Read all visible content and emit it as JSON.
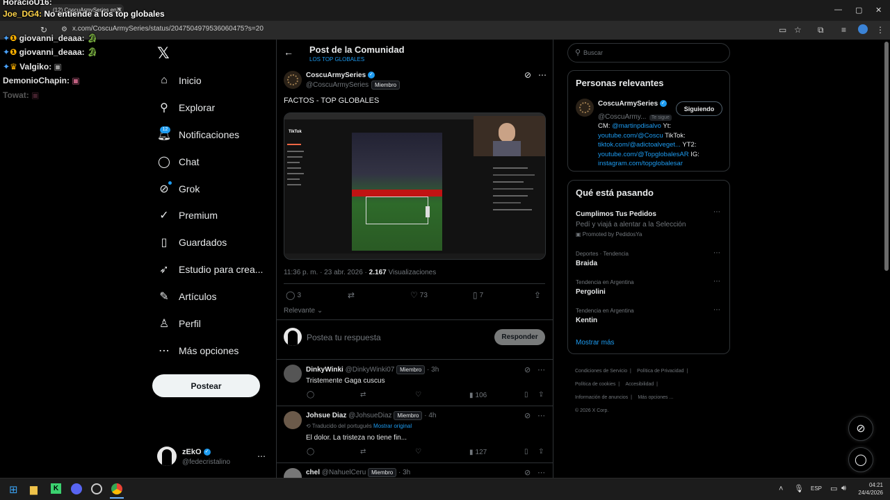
{
  "browser": {
    "tab_title": "(12) CoscuArmySeries en X",
    "url": "x.com/CoscuArmySeries/status/2047504979536060475?s=20"
  },
  "chat_overlay": {
    "top_user": "HoracioU16:",
    "lines": [
      {
        "user": "Joe_DG4:",
        "message": "No entiende a los top globales"
      },
      {
        "user": "giovanni_deaaa:",
        "message": ""
      },
      {
        "user": "giovanni_deaaa:",
        "message": ""
      },
      {
        "user": "Valgiko:",
        "message": ""
      },
      {
        "user": "DemonioChapin:",
        "message": ""
      },
      {
        "user": "Towat:",
        "message": ""
      }
    ]
  },
  "nav": {
    "items": [
      {
        "label": "Inicio",
        "icon": "home-icon",
        "glyph": "⌂"
      },
      {
        "label": "Explorar",
        "icon": "search-icon",
        "glyph": "⚲"
      },
      {
        "label": "Notificaciones",
        "icon": "bell-icon",
        "glyph": "🔔︎"
      },
      {
        "label": "Chat",
        "icon": "chat-icon",
        "glyph": "◯"
      },
      {
        "label": "Grok",
        "icon": "grok-icon",
        "glyph": "⊘"
      },
      {
        "label": "Premium",
        "icon": "premium-icon",
        "glyph": "✓"
      },
      {
        "label": "Guardados",
        "icon": "bookmark-icon",
        "glyph": "▯"
      },
      {
        "label": "Estudio para crea...",
        "icon": "rocket-icon",
        "glyph": "➶"
      },
      {
        "label": "Artículos",
        "icon": "article-icon",
        "glyph": "✎"
      },
      {
        "label": "Perfil",
        "icon": "person-icon",
        "glyph": "♙"
      },
      {
        "label": "Más opciones",
        "icon": "more-circle-icon",
        "glyph": "⋯"
      }
    ],
    "notif_badge": "12",
    "post_label": "Postear",
    "account_name": "zEkO",
    "account_handle": "@fedecristalino"
  },
  "post": {
    "header_title": "Post de la Comunidad",
    "header_sub": "LOS TOP GLOBALES",
    "author_name": "CoscuArmySeries",
    "author_handle": "@CoscuArmySeries",
    "member_tag": "Miembro",
    "text": "FACTOS - TOP GLOBALES",
    "timestamp": "11:36 p. m. · 23 abr. 2026 ·",
    "views": "2.167",
    "views_label": "Visualizaciones",
    "replies": "3",
    "likes": "73",
    "bookmarks": "7",
    "sort_label": "Relevante",
    "reply_placeholder": "Postea tu respuesta",
    "reply_button": "Responder",
    "video_logo": "TikTok"
  },
  "replies": [
    {
      "name": "DinkyWinki",
      "handle": "@DinkyWinki07",
      "tag": "Miembro",
      "time": "3h",
      "translated": "",
      "show_original": "",
      "text": "Tristemente Gaga cuscus",
      "views": "106"
    },
    {
      "name": "Johsue Diaz",
      "handle": "@JohsueDiaz",
      "tag": "Miembro",
      "time": "4h",
      "translated": "Traducido del portugués",
      "show_original": "Mostrar original",
      "text": "El dolor. La tristeza no tiene fin...",
      "views": "127"
    },
    {
      "name": "chel",
      "handle": "@NahuelCeru",
      "tag": "Miembro",
      "time": "3h",
      "translated": "",
      "show_original": "",
      "text": "",
      "views": ""
    }
  ],
  "right": {
    "search_placeholder": "Buscar",
    "relevant_title": "Personas relevantes",
    "relevant_name": "CoscuArmySeries",
    "relevant_handle": "@CoscuArmy...",
    "follows_you": "Te sigue",
    "following_btn": "Siguiendo",
    "bio_1a": "CM: ",
    "bio_1b": "@martinpdisalvo",
    "bio_1c": " Yt:",
    "bio_2a": "youtube.com/@Coscu",
    "bio_2b": " TikTok:",
    "bio_3a": "tiktok.com/@adictoalveget...",
    "bio_3b": " YT2:",
    "bio_4a": "youtube.com/@TopglobalesAR",
    "bio_4b": " IG:",
    "bio_5": "instagram.com/topglobalesar",
    "trending_title": "Qué está pasando",
    "promo_title": "Cumplimos Tus Pedidos",
    "promo_desc": "Pedí y viajá a alentar a la Selección",
    "promo_by": "Promoted by PedidosYa",
    "trends": [
      {
        "context": "Deportes · Tendencia",
        "name": "Braida"
      },
      {
        "context": "Tendencia en Argentina",
        "name": "Pergolini"
      },
      {
        "context": "Tendencia en Argentina",
        "name": "Kentin"
      }
    ],
    "show_more": "Mostrar más",
    "footer": [
      "Condiciones de Servicio",
      "Política de Privacidad",
      "Política de cookies",
      "Accesibilidad",
      "Información de anuncios",
      "Más opciones ...",
      "© 2026 X Corp."
    ]
  },
  "taskbar": {
    "lang": "ESP",
    "time": "04:21",
    "date": "24/4/2026"
  }
}
